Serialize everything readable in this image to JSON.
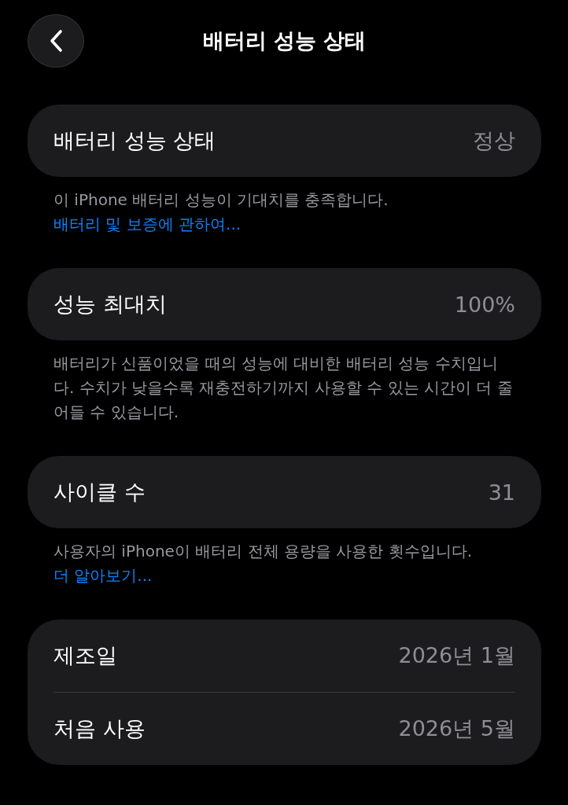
{
  "header": {
    "title": "배터리 성능 상태"
  },
  "sections": [
    {
      "rows": [
        {
          "label": "배터리 성능 상태",
          "value": "정상"
        }
      ],
      "note": {
        "text": "이 iPhone 배터리 성능이 기대치를 충족합니다.",
        "link": "배터리 및 보증에 관하여..."
      }
    },
    {
      "rows": [
        {
          "label": "성능 최대치",
          "value": "100%"
        }
      ],
      "note": {
        "text": "배터리가 신품이었을 때의 성능에 대비한 배터리 성능 수치입니다. 수치가 낮을수록 재충전하기까지 사용할 수 있는 시간이 더 줄어들 수 있습니다."
      }
    },
    {
      "rows": [
        {
          "label": "사이클 수",
          "value": "31"
        }
      ],
      "note": {
        "text": "사용자의 iPhone이 배터리 전체 용량을 사용한 횟수입니다.",
        "link": "더 알아보기..."
      }
    },
    {
      "rows": [
        {
          "label": "제조일",
          "value": "2026년 1월"
        },
        {
          "label": "처음 사용",
          "value": "2026년 5월"
        }
      ]
    }
  ]
}
